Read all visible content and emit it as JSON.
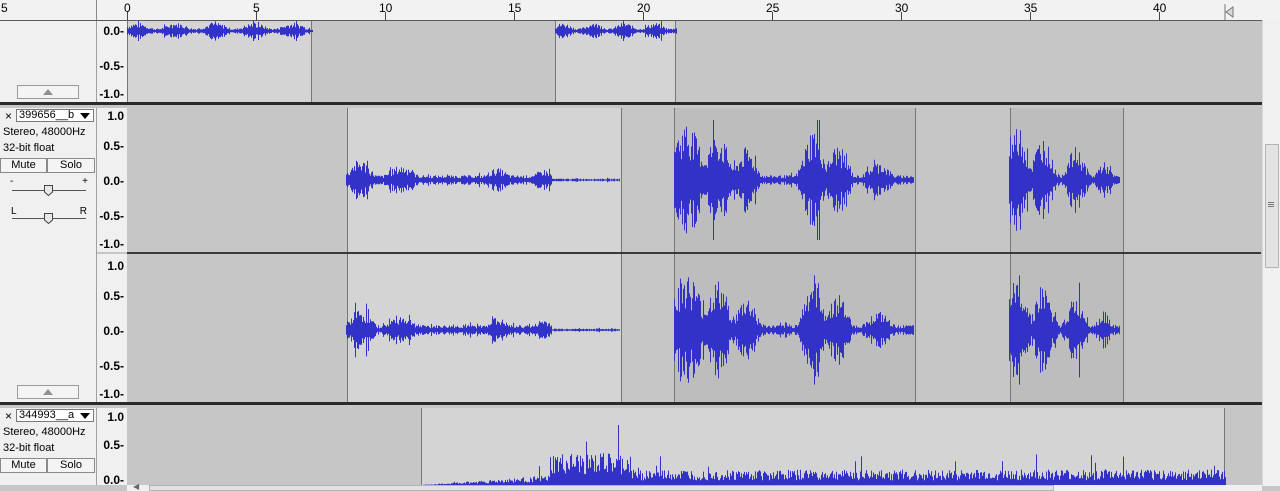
{
  "ruler": {
    "ticks": [
      "5",
      "0",
      "5",
      "10",
      "15",
      "20",
      "25",
      "30",
      "35",
      "40"
    ]
  },
  "tracks": [
    {
      "name": "",
      "channels": [
        {
          "scale": [
            "0.0-",
            "-0.5-",
            "-1.0-"
          ]
        }
      ],
      "clips": [
        [
          0.0,
          7.2
        ],
        [
          16.6,
          21.3
        ]
      ]
    },
    {
      "name": "399656__b",
      "format": "Stereo, 48000Hz",
      "bits": "32-bit float",
      "mute_label": "Mute",
      "solo_label": "Solo",
      "gain_minus": "-",
      "gain_plus": "+",
      "pan_left": "L",
      "pan_right": "R",
      "channels": [
        {
          "scale": [
            "1.0",
            "0.5-",
            "0.0-",
            "-0.5-",
            "-1.0-"
          ]
        },
        {
          "scale": [
            "1.0",
            "0.5-",
            "0.0-",
            "-0.5-",
            "-1.0-"
          ]
        }
      ],
      "clips": [
        [
          8.5,
          19.1
        ],
        [
          21.2,
          30.5
        ],
        [
          34.2,
          38.5
        ]
      ]
    },
    {
      "name": "344993__a",
      "format": "Stereo, 48000Hz",
      "bits": "32-bit float",
      "mute_label": "Mute",
      "solo_label": "Solo",
      "channels": [
        {
          "scale": [
            "1.0",
            "0.5-",
            "0.0-"
          ]
        }
      ],
      "clips": [
        [
          11.4,
          42.6
        ]
      ]
    }
  ],
  "colors": {
    "waveform": "#3232c8",
    "clip_background": "#d4d4d4",
    "selected_background": "#bdbdbd",
    "track_background": "#c6c6c6"
  },
  "icons": [
    "close-icon",
    "dropdown-arrow-icon",
    "collapse-arrow-icon",
    "slider-thumb-icon",
    "play-head-icon"
  ]
}
